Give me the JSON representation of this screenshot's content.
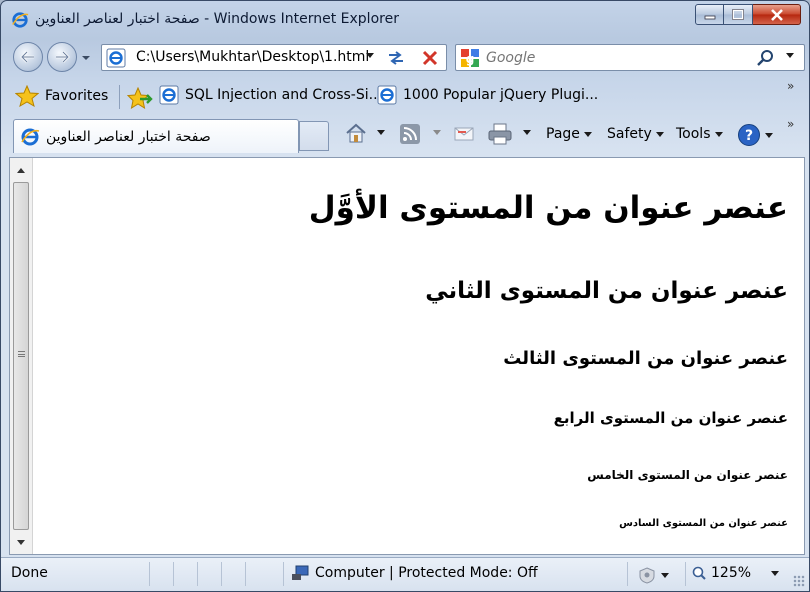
{
  "window": {
    "title": "صفحة اختبار لعناصر العناوين - Windows Internet Explorer",
    "controls": {
      "minimize": "minimize",
      "maximize": "maximize",
      "close": "close"
    }
  },
  "address_bar": {
    "url": "C:\\Users\\Mukhtar\\Desktop\\1.html"
  },
  "search": {
    "placeholder": "Google"
  },
  "favorites_bar": {
    "favorites_label": "Favorites",
    "links": [
      {
        "label": "SQL Injection and Cross-Si..."
      },
      {
        "label": "1000 Popular jQuery Plugi..."
      }
    ],
    "overflow": "»"
  },
  "tab": {
    "title": "صفحة اختبار لعناصر العناوين"
  },
  "command_bar": {
    "page_label": "Page",
    "safety_label": "Safety",
    "tools_label": "Tools",
    "overflow": "»"
  },
  "page": {
    "h1": "عنصر عنوان من المستوى الأوَّل",
    "h2": "عنصر عنوان من المستوى الثاني",
    "h3": "عنصر عنوان من المستوى الثالث",
    "h4": "عنصر عنوان من المستوى الرابع",
    "h5": "عنصر عنوان من المستوى الخامس",
    "h6": "عنصر عنوان من المستوى السادس"
  },
  "status_bar": {
    "status": "Done",
    "zone": "Computer | Protected Mode: Off",
    "zoom": "125%"
  },
  "colors": {
    "accent": "#1d4f91",
    "close_button": "#c23a1f",
    "chrome": "#c3d3e8"
  }
}
